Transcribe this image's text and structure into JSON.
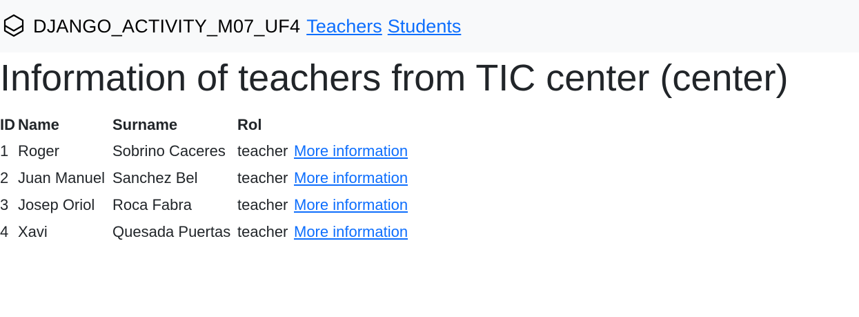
{
  "nav": {
    "brand": "DJANGO_ACTIVITY_M07_UF4",
    "links": [
      "Teachers",
      "Students"
    ]
  },
  "page": {
    "title": "Information of teachers from TIC center (center)"
  },
  "table": {
    "headers": [
      "ID",
      "Name",
      "Surname",
      "Rol"
    ],
    "rows": [
      {
        "id": "1",
        "name": "Roger",
        "surname": "Sobrino Caceres",
        "rol": "teacher",
        "link": "More information"
      },
      {
        "id": "2",
        "name": "Juan Manuel",
        "surname": "Sanchez Bel",
        "rol": "teacher",
        "link": "More information"
      },
      {
        "id": "3",
        "name": "Josep Oriol",
        "surname": "Roca Fabra",
        "rol": "teacher",
        "link": "More information"
      },
      {
        "id": "4",
        "name": "Xavi",
        "surname": "Quesada Puertas",
        "rol": "teacher",
        "link": "More information"
      }
    ]
  },
  "colors": {
    "navbar_bg": "#f8f9fa",
    "link": "#0d6efd",
    "text": "#212529"
  },
  "icons": {
    "logo": "hexagon-logo-icon"
  }
}
